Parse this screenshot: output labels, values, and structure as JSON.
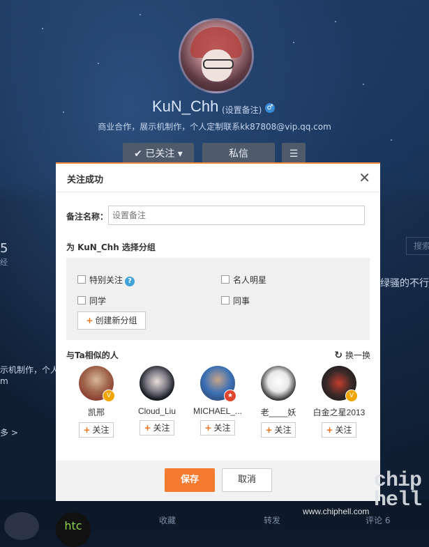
{
  "profile": {
    "name": "KuN_Chh",
    "remark_link": "(设置备注)",
    "gender_icon": "male-icon",
    "bio": "商业合作，展示机制作，个人定制联系kk87808@vip.qq.com",
    "follow_btn": "已关注",
    "message_btn": "私信"
  },
  "background": {
    "left_fragments": [
      "5",
      "经",
      "示机制作，个人",
      "m",
      "多 >"
    ],
    "right_fragments": [
      "搜索",
      "绿骚的不行。"
    ],
    "bottom": [
      "收藏",
      "转发",
      "评论 6"
    ],
    "htc_logo": "htc"
  },
  "dialog": {
    "title": "关注成功",
    "remark_label": "备注名称：",
    "remark_placeholder": "设置备注",
    "group_label": "为 KuN_Chh 选择分组",
    "groups": [
      "特别关注",
      "名人明星",
      "同学",
      "同事"
    ],
    "new_group": "创建新分组",
    "similar_title": "与Ta相似的人",
    "refresh": "换一换",
    "people": [
      {
        "name": "凯邢",
        "badge": "V"
      },
      {
        "name": "Cloud_Liu",
        "badge": ""
      },
      {
        "name": "MICHAEL_...",
        "badge": "★"
      },
      {
        "name": "老____妖",
        "badge": ""
      },
      {
        "name": "白金之星2013",
        "badge": "V"
      }
    ],
    "follow_label": "关注",
    "save": "保存",
    "cancel": "取消"
  },
  "watermark": {
    "url": "www.chiphell.com",
    "logo": "chip hell"
  },
  "colors": {
    "accent": "#f47b30",
    "badge_gold": "#f0a500",
    "badge_red": "#e0452e",
    "help": "#3fa3d8"
  }
}
